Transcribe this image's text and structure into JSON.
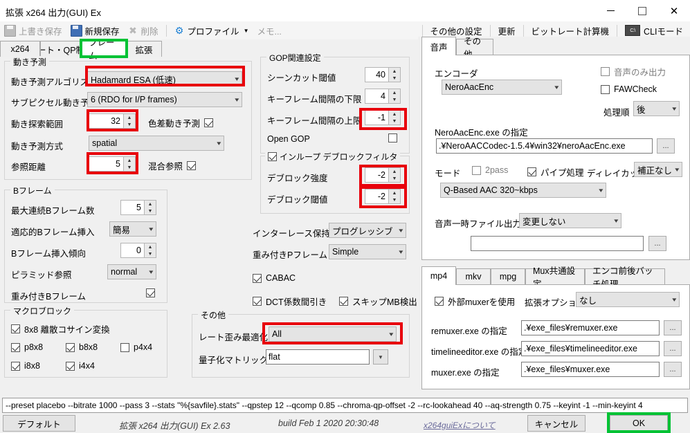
{
  "window": {
    "title": "拡張 x264 出力(GUI) Ex",
    "minimize": "—",
    "maximize": "□",
    "close": "✕"
  },
  "toolbar": {
    "overwrite_save": "上書き保存",
    "save_new": "新規保存",
    "delete": "削除",
    "profile": "プロファイル",
    "profile_caret": "▼",
    "memo": "メモ...",
    "other_settings": "その他の設定",
    "update": "更新",
    "bitrate_calc": "ビットレート計算機",
    "cli_icon_text": "C:\\",
    "cli_mode": "CLIモード"
  },
  "left_tabs": [
    {
      "label": "x264"
    },
    {
      "label": "レート・QP制御"
    },
    {
      "label": "フレーム"
    },
    {
      "label": "拡張"
    }
  ],
  "left_tab_active": "フレーム",
  "motion_estimation": {
    "group_label": "動き予測",
    "algorithm_label": "動き予測アルゴリズム",
    "algorithm_value": "Hadamard ESA (低速)",
    "subpixel_label": "サブピクセル動き予測",
    "subpixel_value": "6 (RDO for I/P frames)",
    "search_range_label": "動き探索範囲",
    "search_range_value": "32",
    "chroma_me_label": "色差動き予測",
    "chroma_me_checked": true,
    "method_label": "動き予測方式",
    "method_value": "spatial",
    "ref_distance_label": "参照距離",
    "ref_distance_value": "5",
    "mixed_ref_label": "混合参照",
    "mixed_ref_checked": true
  },
  "bframe": {
    "group_label": "Bフレーム",
    "max_consecutive_label": "最大連続Bフレーム数",
    "max_consecutive_value": "5",
    "adaptive_label": "適応的Bフレーム挿入",
    "adaptive_value": "簡易",
    "bias_label": "Bフレーム挿入傾向",
    "bias_value": "0",
    "pyramid_label": "ピラミッド参照",
    "pyramid_value": "normal",
    "weighted_label": "重み付きBフレーム",
    "weighted_checked": true
  },
  "macroblock": {
    "group_label": "マクロブロック",
    "dct8x8_label": "8x8 離散コサイン変換",
    "dct8x8_checked": true,
    "p8x8_label": "p8x8",
    "p8x8_checked": true,
    "b8x8_label": "b8x8",
    "b8x8_checked": true,
    "p4x4_label": "p4x4",
    "p4x4_checked": false,
    "i8x8_label": "i8x8",
    "i8x8_checked": true,
    "i4x4_label": "i4x4",
    "i4x4_checked": true
  },
  "gop": {
    "group_label": "GOP関連設定",
    "scenecut_label": "シーンカット閾値",
    "scenecut_value": "40",
    "min_keyint_label": "キーフレーム間隔の下限",
    "min_keyint_value": "4",
    "max_keyint_label": "キーフレーム間隔の上限",
    "max_keyint_value": "-1",
    "open_gop_label": "Open GOP",
    "open_gop_checked": false
  },
  "deblock": {
    "group_label": "インループ デブロックフィルタ",
    "group_checked": true,
    "strength_label": "デブロック強度",
    "strength_value": "-2",
    "threshold_label": "デブロック閾値",
    "threshold_value": "-2"
  },
  "misc_mid": {
    "interlace_label": "インターレース保持",
    "interlace_value": "プログレッシブ",
    "weighted_p_label": "重み付きPフレーム",
    "weighted_p_value": "Simple",
    "cabac_label": "CABAC",
    "cabac_checked": true,
    "dct_decimate_label": "DCT係数間引き",
    "dct_decimate_checked": true,
    "skip_mb_label": "スキップMB検出",
    "skip_mb_checked": true
  },
  "other_group": {
    "group_label": "その他",
    "trellis_label": "レート歪み最適化",
    "trellis_value": "All",
    "cqm_label": "量子化マトリックス",
    "cqm_value": "flat",
    "cqm_arrow": "▼"
  },
  "audio": {
    "tabs": [
      {
        "label": "音声"
      },
      {
        "label": "その他"
      }
    ],
    "active_tab": "音声",
    "audio_only_label": "音声のみ出力",
    "audio_only_checked": false,
    "fawcheck_label": "FAWCheck",
    "fawcheck_checked": false,
    "encoder_label": "エンコーダ",
    "encoder_value": "NeroAacEnc",
    "order_label": "処理順",
    "order_value": "後",
    "exe_path_label": "NeroAacEnc.exe の指定",
    "exe_path_value": ".¥NeroAACCodec-1.5.4¥win32¥neroAacEnc.exe",
    "browse": "...",
    "mode_label": "モード",
    "twopass_label": "2pass",
    "twopass_checked": false,
    "pipe_label": "パイプ処理",
    "pipe_checked": true,
    "delaycut_label": "ディレイカット",
    "delaycut_value": "補正なし",
    "bitrate_mode_value": "Q-Based AAC 320~kbps",
    "temp_label": "音声一時ファイル出力先",
    "temp_value": "変更しない",
    "temp_path_value": ""
  },
  "muxer": {
    "tabs": [
      {
        "label": "mp4"
      },
      {
        "label": "mkv"
      },
      {
        "label": "mpg"
      },
      {
        "label": "Mux共通設定"
      },
      {
        "label": "エンコ前後バッチ処理"
      }
    ],
    "active_tab": "mp4",
    "use_external_label": "外部muxerを使用",
    "use_external_checked": true,
    "ext_option_label": "拡張オプション",
    "ext_option_value": "なし",
    "remuxer_label": "remuxer.exe の指定",
    "remuxer_value": ".¥exe_files¥remuxer.exe",
    "timelineeditor_label": "timelineeditor.exe の指定",
    "timelineeditor_value": ".¥exe_files¥timelineeditor.exe",
    "muxer_label": "muxer.exe の指定",
    "muxer_value": ".¥exe_files¥muxer.exe",
    "browse": "..."
  },
  "bottom": {
    "cmdline": "--preset placebo --bitrate 1000 --pass 3 --stats \"%{savfile}.stats\" --qpstep 12 --qcomp 0.85 --chroma-qp-offset -2 --rc-lookahead 40 --aq-strength 0.75 --keyint -1 --min-keyint 4",
    "default_button": "デフォルト",
    "version": "拡張 x264 出力(GUI) Ex 2.63",
    "build": "build Feb  1 2020 20:30:48",
    "about_link": "x264guiExについて",
    "cancel_button": "キャンセル",
    "ok_button": "OK"
  },
  "highlight_color_red": "#e8000b",
  "highlight_color_green": "#00c234"
}
